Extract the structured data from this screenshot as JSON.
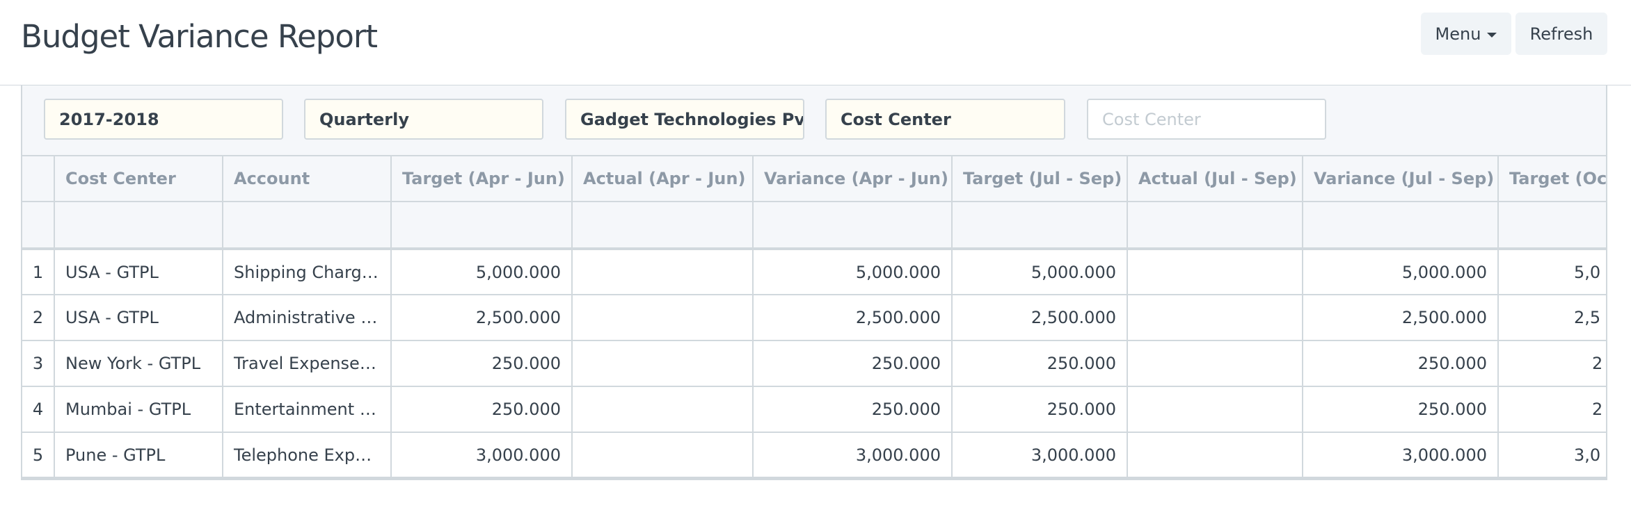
{
  "header": {
    "title": "Budget Variance Report",
    "menu_label": "Menu",
    "refresh_label": "Refresh"
  },
  "filters": {
    "fiscal_year": "2017-2018",
    "period": "Quarterly",
    "company": "Gadget Technologies Pvt",
    "budget_against": "Cost Center",
    "cost_center_placeholder": "Cost Center"
  },
  "table": {
    "columns": [
      "",
      "Cost Center",
      "Account",
      "Target (Apr - Jun)",
      "Actual (Apr - Jun)",
      "Variance (Apr - Jun)",
      "Target (Jul - Sep)",
      "Actual (Jul - Sep)",
      "Variance (Jul - Sep)",
      "Target (Oct"
    ],
    "rows": [
      {
        "idx": "1",
        "cost_center": "USA - GTPL",
        "account": "Shipping Charge…",
        "target_q1": "5,000.000",
        "actual_q1": "",
        "variance_q1": "5,000.000",
        "target_q2": "5,000.000",
        "actual_q2": "",
        "variance_q2": "5,000.000",
        "target_q3": "5,0"
      },
      {
        "idx": "2",
        "cost_center": "USA - GTPL",
        "account": "Administrative E…",
        "target_q1": "2,500.000",
        "actual_q1": "",
        "variance_q1": "2,500.000",
        "target_q2": "2,500.000",
        "actual_q2": "",
        "variance_q2": "2,500.000",
        "target_q3": "2,5"
      },
      {
        "idx": "3",
        "cost_center": "New York - GTPL",
        "account": "Travel Expenses …",
        "target_q1": "250.000",
        "actual_q1": "",
        "variance_q1": "250.000",
        "target_q2": "250.000",
        "actual_q2": "",
        "variance_q2": "250.000",
        "target_q3": "2"
      },
      {
        "idx": "4",
        "cost_center": "Mumbai - GTPL",
        "account": "Entertainment E…",
        "target_q1": "250.000",
        "actual_q1": "",
        "variance_q1": "250.000",
        "target_q2": "250.000",
        "actual_q2": "",
        "variance_q2": "250.000",
        "target_q3": "2"
      },
      {
        "idx": "5",
        "cost_center": "Pune - GTPL",
        "account": "Telephone Expe…",
        "target_q1": "3,000.000",
        "actual_q1": "",
        "variance_q1": "3,000.000",
        "target_q2": "3,000.000",
        "actual_q2": "",
        "variance_q2": "3,000.000",
        "target_q3": "3,0"
      }
    ]
  }
}
